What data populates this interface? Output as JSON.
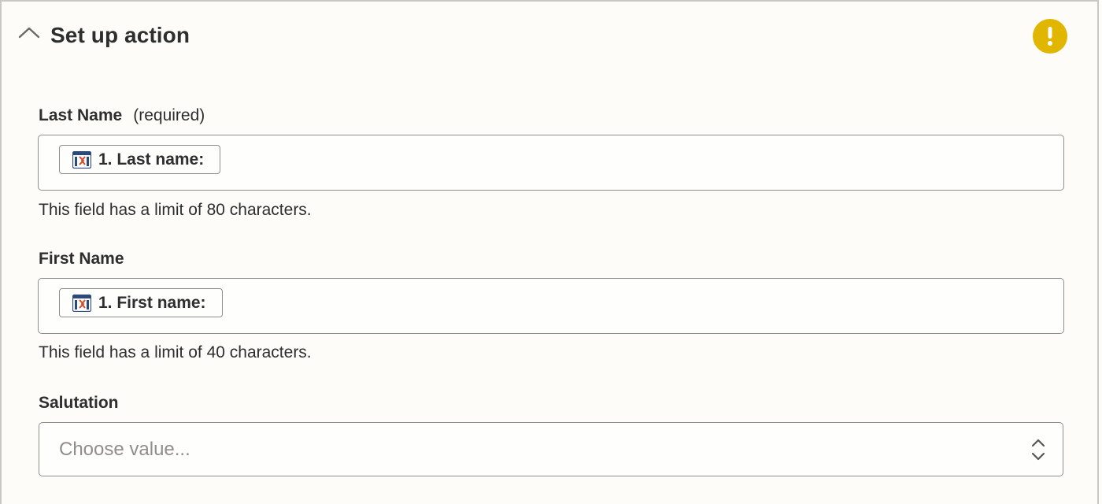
{
  "header": {
    "title": "Set up action"
  },
  "fields": {
    "last_name": {
      "label": "Last Name",
      "required": "(required)",
      "pill": "1. Last name:",
      "help": "This field has a limit of 80 characters."
    },
    "first_name": {
      "label": "First Name",
      "pill": "1. First name:",
      "help": "This field has a limit of 40 characters."
    },
    "salutation": {
      "label": "Salutation",
      "placeholder": "Choose value..."
    }
  },
  "icons": {
    "collapse": "chevron-up-icon",
    "warning": "exclamation-icon",
    "field_source": "app-logo-icon",
    "select": "up-down-chevron-icon"
  },
  "colors": {
    "background": "#fdfcf8",
    "warning": "#e0b600",
    "border": "#8f8e89",
    "text": "#2d2e2e",
    "placeholder": "#8f8e89"
  }
}
